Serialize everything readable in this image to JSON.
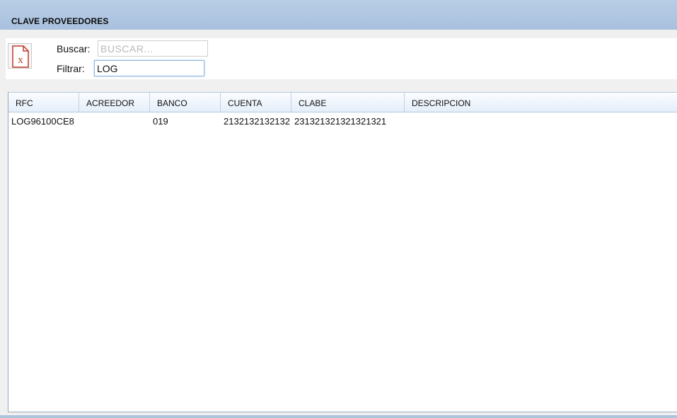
{
  "panel": {
    "title": "CLAVE PROVEEDORES"
  },
  "toolbar": {
    "export_icon": "excel-export-icon",
    "buscar_label": "Buscar:",
    "buscar_value": "",
    "buscar_placeholder": "BUSCAR...",
    "filtrar_label": "Filtrar:",
    "filtrar_value": "LOG"
  },
  "grid": {
    "columns": [
      "RFC",
      "ACREEDOR",
      "BANCO",
      "CUENTA",
      "CLABE",
      "DESCRIPCION"
    ],
    "rows": [
      {
        "rfc": "LOG96100CE8",
        "acreedor": "",
        "banco": "019",
        "cuenta": "2132132132132",
        "clabe": "231321321321321321",
        "descripcion": ""
      }
    ]
  },
  "colors": {
    "header_bg": "#aec4dd",
    "excel_red": "#c0392b"
  }
}
